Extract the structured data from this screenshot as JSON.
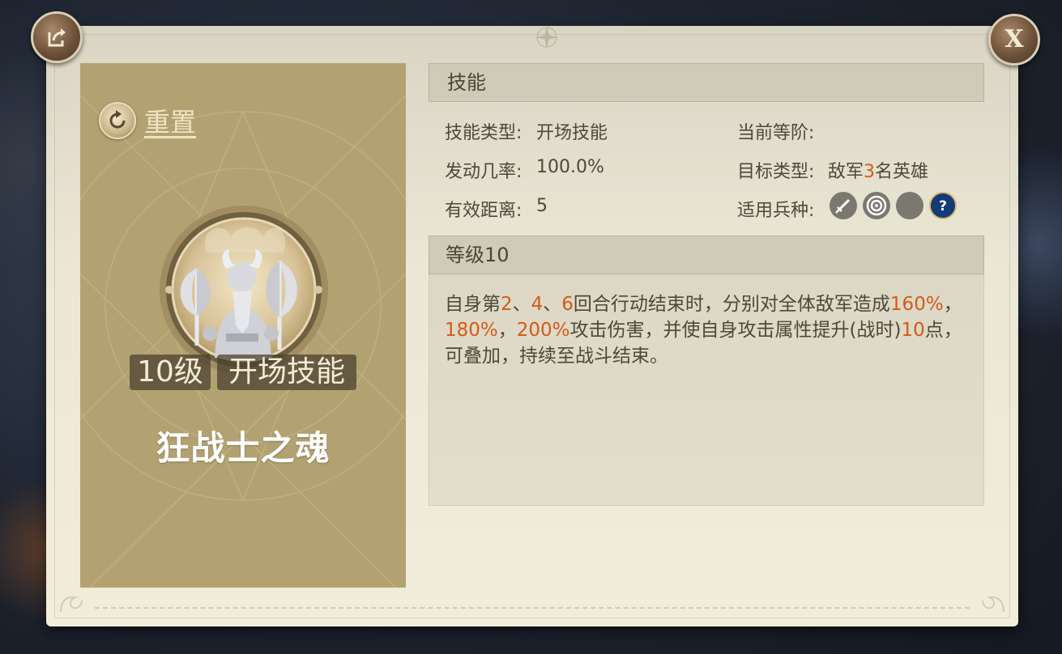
{
  "buttons": {
    "share_icon": "share-icon",
    "close_label": "X"
  },
  "skill_card": {
    "reset_label": "重置",
    "level_tag": "10级",
    "type_tag": "开场技能",
    "name": "狂战士之魂",
    "emblem_icon": "berserker-warrior-icon"
  },
  "skill_section": {
    "title": "技能",
    "type_label": "技能类型:",
    "type_value": "开场技能",
    "current_rank_label": "当前等阶:",
    "trigger_rate_label": "发动几率:",
    "trigger_rate_value": "100.0%",
    "target_type_label": "目标类型:",
    "target_type_prefix": "敌军",
    "target_type_count": "3",
    "target_type_suffix": "名英雄",
    "range_label": "有效距离:",
    "range_value": "5",
    "troop_types_label": "适用兵种:",
    "troop_icons": [
      "sword-icon",
      "target-icon",
      "empty-slot-icon",
      "help-icon"
    ]
  },
  "level_section": {
    "title": "等级10",
    "description": {
      "t1": "自身第",
      "n1": "2",
      "t2": "、",
      "n2": "4",
      "t3": "、",
      "n3": "6",
      "t4": "回合行动结束时，分别对全体敌军造成",
      "p1": "160%",
      "t5": "，",
      "p2": "180%",
      "t6": "，",
      "p3": "200%",
      "t7": "攻击伤害，并使自身攻击属性提升(战时)",
      "n4": "10",
      "t8": "点，可叠加，持续至战斗结束。"
    }
  },
  "colors": {
    "highlight": "#d45a1a",
    "card_bg": "#b3a271",
    "panel_bg": "#ebe7d5",
    "help_icon_bg": "#143a78"
  }
}
